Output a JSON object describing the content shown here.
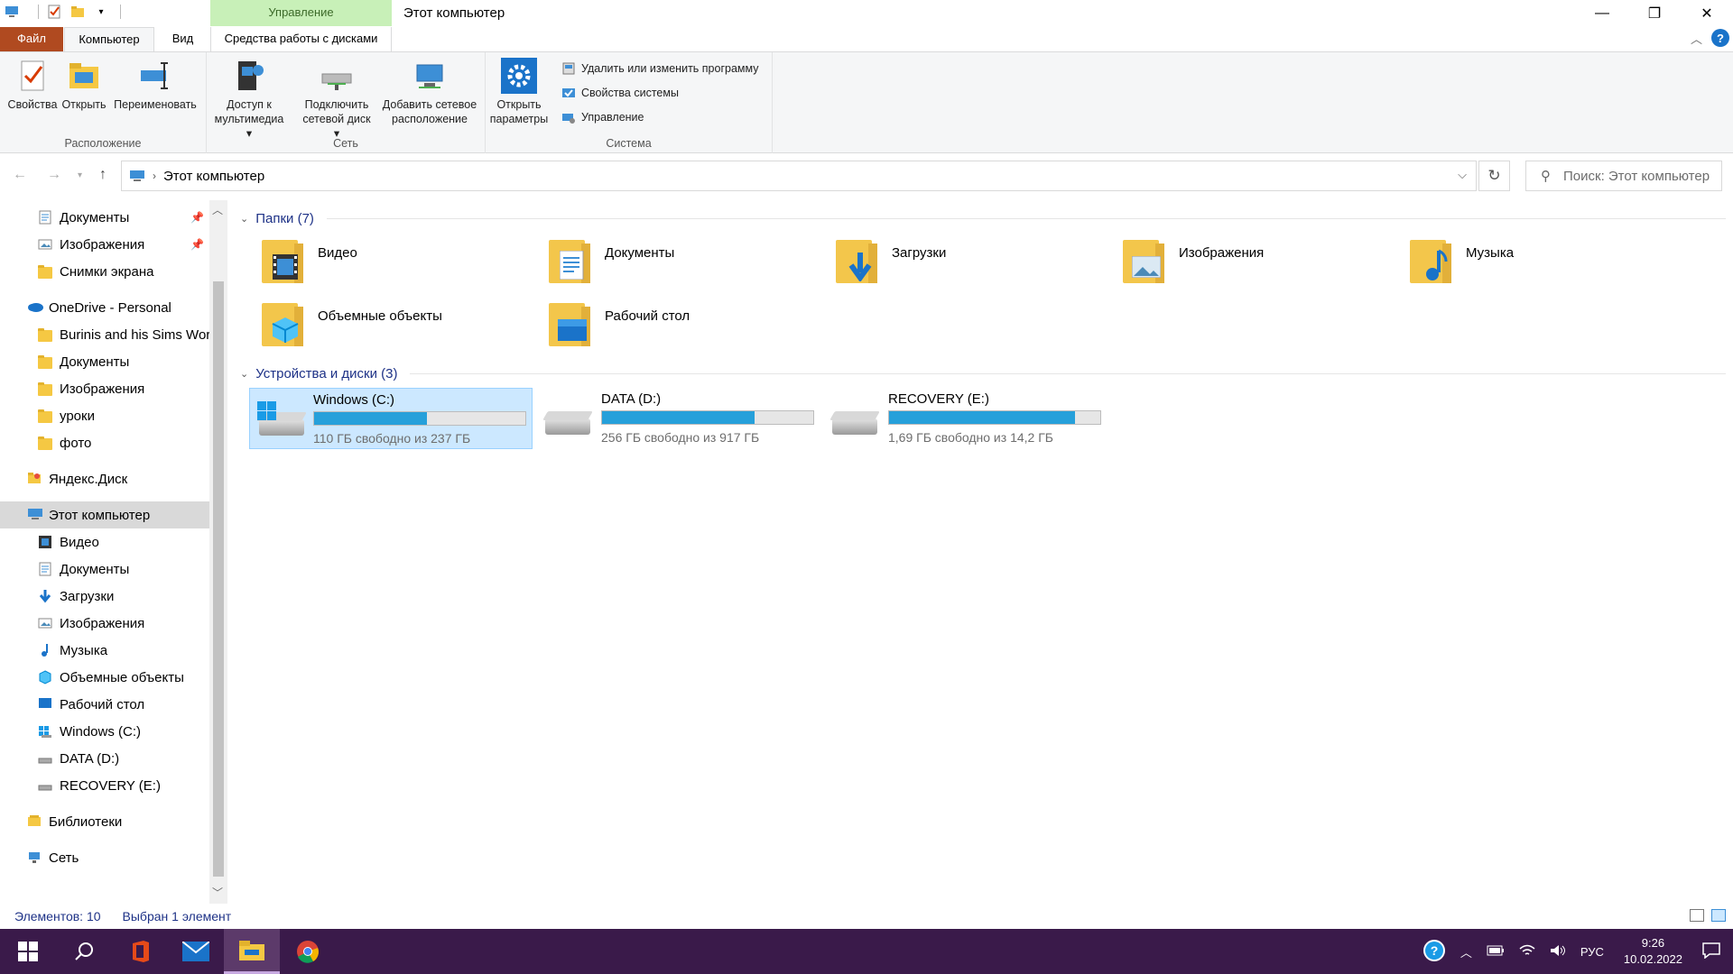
{
  "window": {
    "title": "Этот компьютер",
    "context_tab_group": "Управление",
    "minimize": "—",
    "maximize": "❐",
    "close": "✕"
  },
  "ribbon_tabs": {
    "file": "Файл",
    "computer": "Компьютер",
    "view": "Вид",
    "disk_tools": "Средства работы с дисками"
  },
  "ribbon": {
    "location": {
      "label": "Расположение",
      "properties": "Свойства",
      "open": "Открыть",
      "rename": "Переименовать"
    },
    "network": {
      "label": "Сеть",
      "media_access_1": "Доступ к",
      "media_access_2": "мультимедиа",
      "map_drive_1": "Подключить",
      "map_drive_2": "сетевой диск",
      "add_location_1": "Добавить сетевое",
      "add_location_2": "расположение"
    },
    "system": {
      "label": "Система",
      "open_settings_1": "Открыть",
      "open_settings_2": "параметры",
      "uninstall": "Удалить или изменить программу",
      "system_properties": "Свойства системы",
      "manage": "Управление"
    }
  },
  "address": {
    "path": "Этот компьютер",
    "search_placeholder": "Поиск: Этот компьютер"
  },
  "nav_pane": {
    "quick": [
      {
        "label": "Документы"
      },
      {
        "label": "Изображения"
      },
      {
        "label": "Снимки экрана"
      }
    ],
    "onedrive": "OneDrive - Personal",
    "onedrive_items": [
      {
        "label": "Burinis and his Sims World"
      },
      {
        "label": "Документы"
      },
      {
        "label": "Изображения"
      },
      {
        "label": "уроки"
      },
      {
        "label": "фото"
      }
    ],
    "yandex": "Яндекс.Диск",
    "this_pc": "Этот компьютер",
    "pc_items": [
      {
        "label": "Видео"
      },
      {
        "label": "Документы"
      },
      {
        "label": "Загрузки"
      },
      {
        "label": "Изображения"
      },
      {
        "label": "Музыка"
      },
      {
        "label": "Объемные объекты"
      },
      {
        "label": "Рабочий стол"
      },
      {
        "label": "Windows (C:)"
      },
      {
        "label": "DATA (D:)"
      },
      {
        "label": "RECOVERY (E:)"
      }
    ],
    "libraries": "Библиотеки",
    "network": "Сеть"
  },
  "content": {
    "folders_header": "Папки (7)",
    "folders": [
      {
        "name": "Видео"
      },
      {
        "name": "Документы"
      },
      {
        "name": "Загрузки"
      },
      {
        "name": "Изображения"
      },
      {
        "name": "Музыка"
      },
      {
        "name": "Объемные объекты"
      },
      {
        "name": "Рабочий стол"
      }
    ],
    "devices_header": "Устройства и диски (3)",
    "drives": [
      {
        "name": "Windows (C:)",
        "free": "110 ГБ свободно из 237 ГБ",
        "used_fraction": 0.536
      },
      {
        "name": "DATA (D:)",
        "free": "256 ГБ свободно из 917 ГБ",
        "used_fraction": 0.721
      },
      {
        "name": "RECOVERY (E:)",
        "free": "1,69 ГБ свободно из 14,2 ГБ",
        "used_fraction": 0.881
      }
    ]
  },
  "status": {
    "items": "Элементов: 10",
    "selected": "Выбран 1 элемент"
  },
  "taskbar": {
    "lang": "РУС",
    "time": "9:26",
    "date": "10.02.2022"
  },
  "colors": {
    "accent": "#26a0da",
    "file_tab": "#b04a20",
    "context_tab": "#c8f0b8",
    "taskbar": "#3a1a4a",
    "selection": "#cce8ff"
  }
}
